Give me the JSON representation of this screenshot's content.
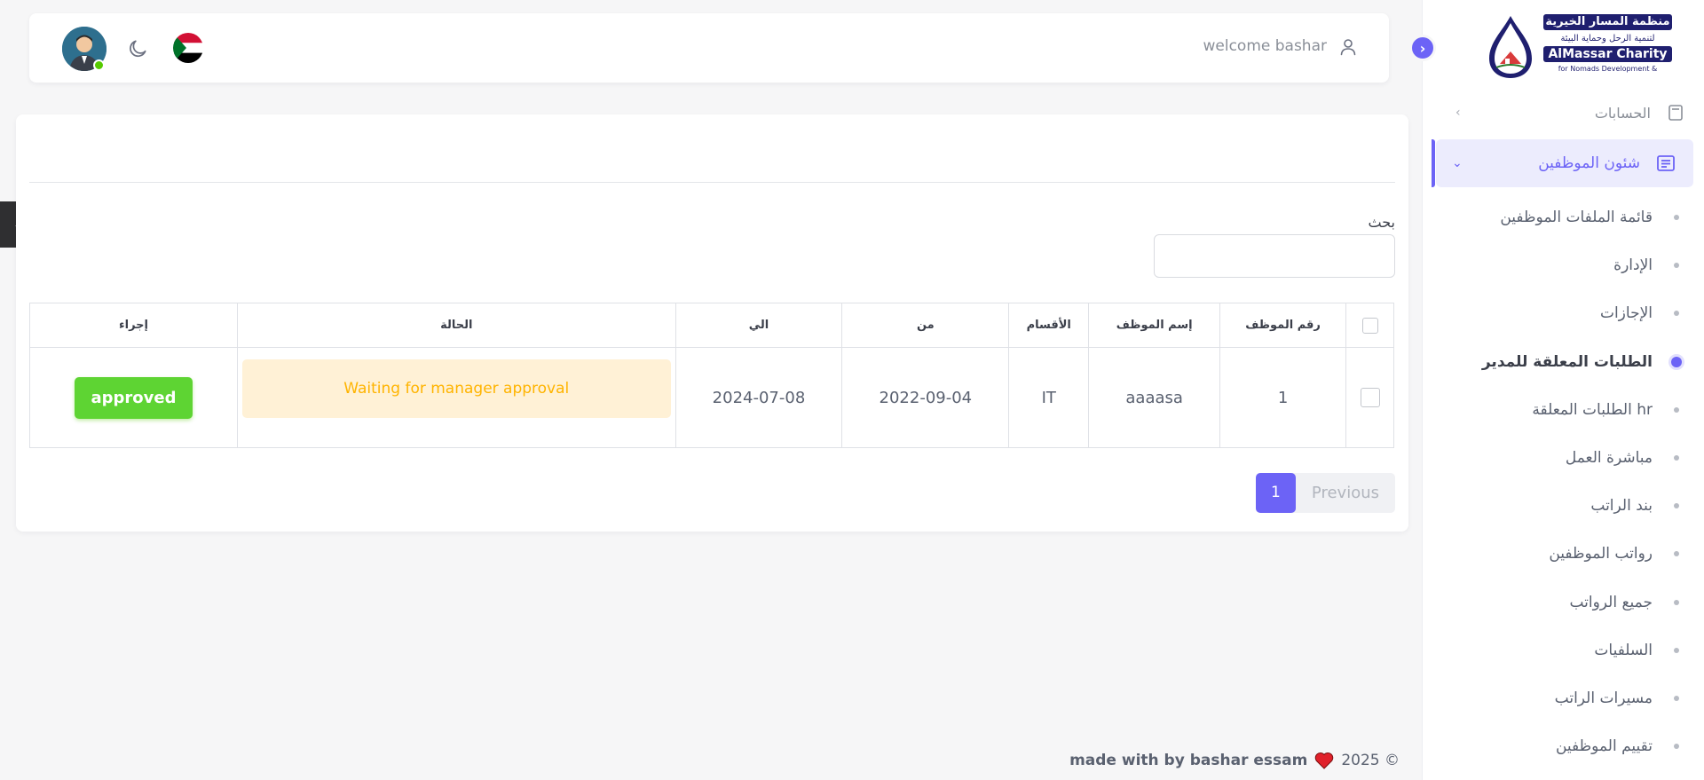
{
  "sidebar": {
    "logo": {
      "line1": "منظمة المسار الخيرية",
      "line2": "لتنمية الرحل وحماية البيئة",
      "line3": "AlMassar Charity",
      "line4": "for Nomads Development &"
    },
    "partial_item": {
      "label": "الحسابات",
      "icon": "calculator-icon"
    },
    "active_group": {
      "label": "شئون الموظفين",
      "icon": "document-list-icon"
    },
    "items": [
      {
        "label": "قائمة الملفات الموظفين"
      },
      {
        "label": "الإدارة"
      },
      {
        "label": "الإجازات"
      },
      {
        "label": "الطلبات المعلقة للمدير"
      },
      {
        "label": "الطلبات المعلقة hr"
      },
      {
        "label": "مباشرة العمل"
      },
      {
        "label": "بند الراتب"
      },
      {
        "label": "رواتب الموظفين"
      },
      {
        "label": "جميع الرواتب"
      },
      {
        "label": "السلفيات"
      },
      {
        "label": "مسيرات الراتب"
      },
      {
        "label": "تقييم الموظفين"
      }
    ],
    "current_index": 3,
    "accent_color": "#6c63f6"
  },
  "header": {
    "welcome": "welcome bashar"
  },
  "search": {
    "label": "بحث",
    "value": ""
  },
  "table": {
    "headers": {
      "employee_no": "رقم الموظف",
      "employee_name": "إسم الموظف",
      "department": "الأقسام",
      "from": "من",
      "to": "الي",
      "status": "الحالة",
      "action": "إجراء"
    },
    "rows": [
      {
        "employee_no": "1",
        "employee_name": "aaaasa",
        "department": "IT",
        "from": "2022-09-04",
        "to": "2024-07-08",
        "status": "Waiting for manager approval",
        "action": "approved"
      }
    ]
  },
  "pagination": {
    "previous": "Previous",
    "current": "1"
  },
  "footer": {
    "text": "made with by bashar essam",
    "year": "2025 ©"
  },
  "colors": {
    "primary": "#6c63f6",
    "success": "#5ed433",
    "warning": "#ffb400",
    "warning_bg": "#fff1d6"
  }
}
